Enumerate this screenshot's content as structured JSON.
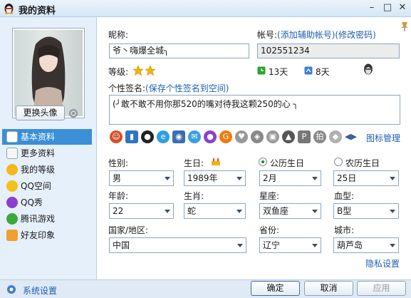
{
  "window": {
    "title": "我的资料"
  },
  "sidebar": {
    "change_avatar": "更换头像",
    "items": [
      {
        "label": "基本资料"
      },
      {
        "label": "更多资料"
      },
      {
        "label": "我的等级"
      },
      {
        "label": "QQ空间"
      },
      {
        "label": "QQ秀"
      },
      {
        "label": "腾讯游戏"
      },
      {
        "label": "好友印象"
      }
    ]
  },
  "profile": {
    "nickname_label": "昵称:",
    "nickname": "爷丶嗨爆全城╮",
    "account_label": "帐号:",
    "add_account_link": "(添加辅助帐号)",
    "change_password_link": "(修改密码)",
    "account": "102551234",
    "level_label": "等级:",
    "days_active": "13天",
    "days_remaining": "8天",
    "signature_label": "个性签名:",
    "save_signature_link": "(保存个性签名到空间)",
    "signature": "(╯敢不敢不用你那520的嘴对待我这颗250的心 ╮",
    "icon_manage": "图标管理"
  },
  "fields": {
    "gender": {
      "label": "性别:",
      "value": "男"
    },
    "birthday": {
      "label": "生日:",
      "year": "1989年",
      "month": "2月",
      "day": "25日"
    },
    "solar": "公历生日",
    "lunar": "农历生日",
    "age": {
      "label": "年龄:",
      "value": "22"
    },
    "zodiac": {
      "label": "生肖:",
      "value": "蛇"
    },
    "constellation": {
      "label": "星座:",
      "value": "双鱼座"
    },
    "blood": {
      "label": "血型:",
      "value": "B型"
    },
    "country": {
      "label": "国家/地区:",
      "value": "中国"
    },
    "province": {
      "label": "省份:",
      "value": "辽宁"
    },
    "city": {
      "label": "城市:",
      "value": "葫芦岛"
    },
    "privacy_link": "隐私设置"
  },
  "footer": {
    "settings": "系统设置",
    "ok": "确定",
    "cancel": "取消",
    "apply": "应用"
  },
  "colors": {
    "accent": "#3b8fd6",
    "link": "#1c5fb3",
    "sidebar_bg": "#e6f0fa"
  }
}
